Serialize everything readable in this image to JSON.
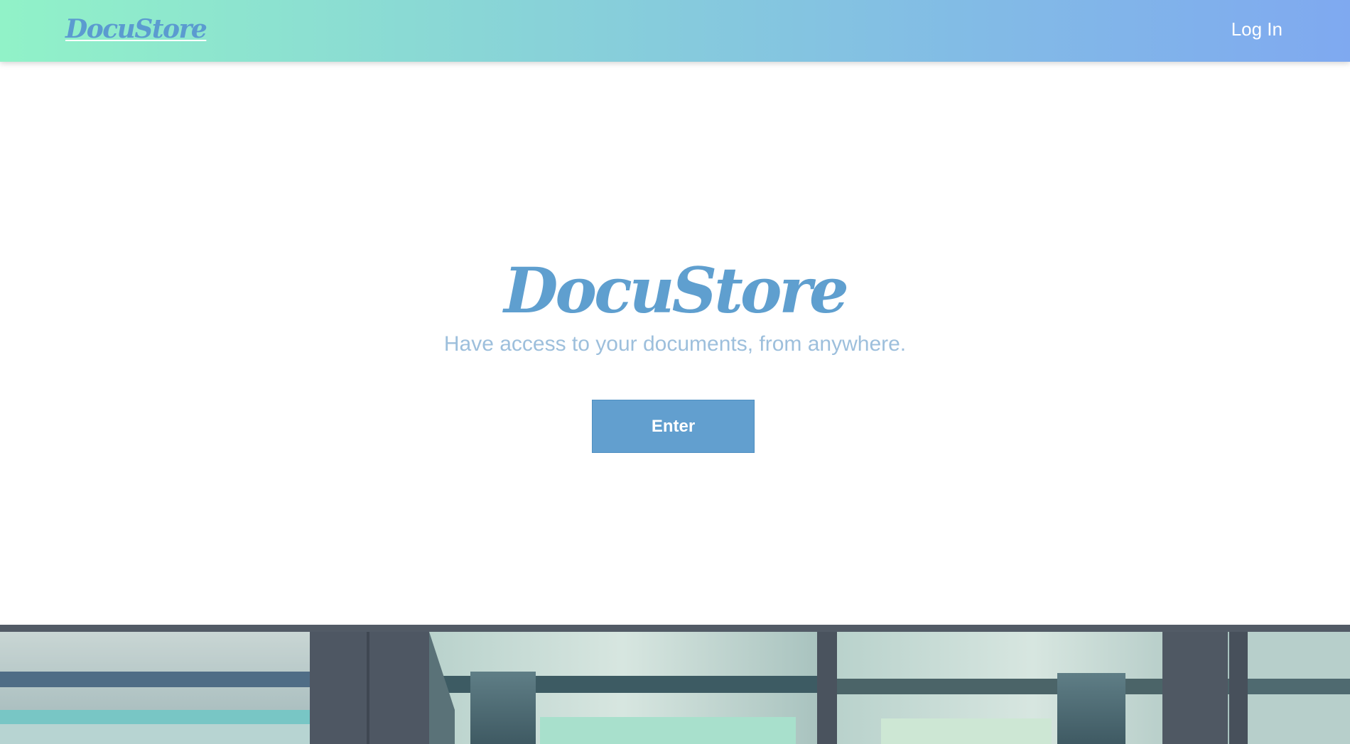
{
  "navbar": {
    "logo_text": "DocuStore",
    "login_label": "Log In"
  },
  "hero": {
    "title": "DocuStore",
    "subtitle": "Have access to your documents, from anywhere.",
    "enter_label": "Enter"
  },
  "colors": {
    "gradient_start": "#91f2c8",
    "gradient_end": "#7fa9f0",
    "brand_blue": "#5f9fcf",
    "subtitle": "#9dbfdc",
    "button": "#629fcf"
  }
}
